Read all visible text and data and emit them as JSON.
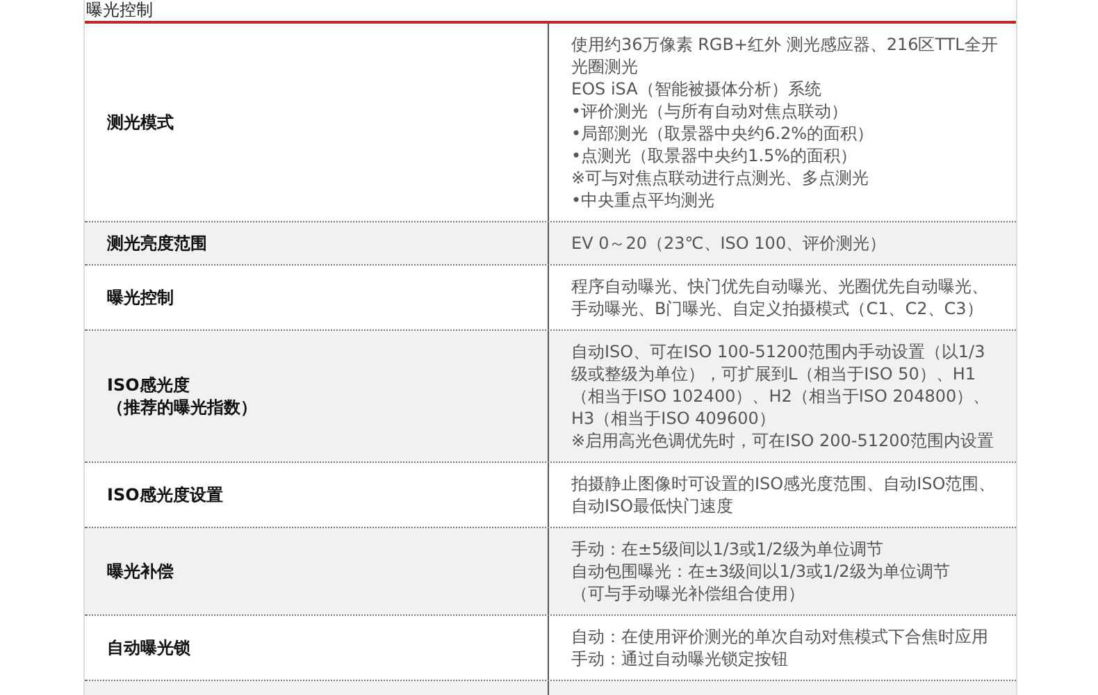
{
  "section_title": "曝光控制",
  "rows": [
    {
      "label": [
        "测光模式"
      ],
      "value": [
        "使用约36万像素 RGB+红外 测光感应器、216区TTL全开光圈测光",
        "EOS iSA（智能被摄体分析）系统",
        "•评价测光（与所有自动对焦点联动）",
        "•局部测光（取景器中央约6.2%的面积）",
        "•点测光（取景器中央约1.5%的面积）",
        "※可与对焦点联动进行点测光、多点测光",
        "•中央重点平均测光"
      ]
    },
    {
      "label": [
        "测光亮度范围"
      ],
      "value": [
        "EV 0～20（23℃、ISO 100、评价测光）"
      ]
    },
    {
      "label": [
        "曝光控制"
      ],
      "value": [
        "程序自动曝光、快门优先自动曝光、光圈优先自动曝光、手动曝光、B门曝光、自定义拍摄模式（C1、C2、C3）"
      ]
    },
    {
      "label": [
        "ISO感光度",
        "（推荐的曝光指数）"
      ],
      "value": [
        "自动ISO、可在ISO 100-51200范围内手动设置（以1/3级或整级为单位），可扩展到L（相当于ISO 50）、H1（相当于ISO 102400）、H2（相当于ISO 204800）、H3（相当于ISO 409600）",
        "※启用高光色调优先时，可在ISO 200-51200范围内设置"
      ]
    },
    {
      "label": [
        "ISO感光度设置"
      ],
      "value": [
        "拍摄静止图像时可设置的ISO感光度范围、自动ISO范围、自动ISO最低快门速度"
      ]
    },
    {
      "label": [
        "曝光补偿"
      ],
      "value": [
        "手动：在±5级间以1/3或1/2级为单位调节",
        "自动包围曝光：在±3级间以1/3或1/2级为单位调节",
        "（可与手动曝光补偿组合使用）"
      ]
    },
    {
      "label": [
        "自动曝光锁"
      ],
      "value": [
        "自动：在使用评价测光的单次自动对焦模式下合焦时应用",
        "手动：通过自动曝光锁定按钮"
      ]
    }
  ]
}
